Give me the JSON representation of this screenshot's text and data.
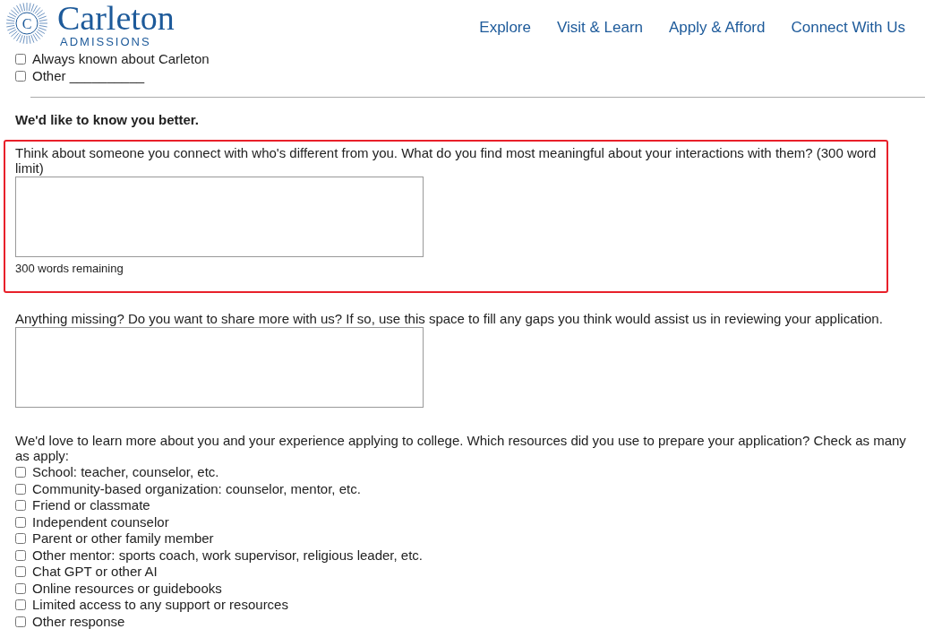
{
  "header": {
    "logo": {
      "title": "Carleton",
      "subtitle": "ADMISSIONS",
      "mark": "C"
    },
    "nav": [
      "Explore",
      "Visit & Learn",
      "Apply & Afford",
      "Connect With Us"
    ]
  },
  "top_options": [
    {
      "label": "Always known about Carleton",
      "checked": false
    },
    {
      "label": "Other __________",
      "checked": false
    }
  ],
  "section_title": "We'd like to know you better.",
  "questions": [
    {
      "prompt": "Think about someone you connect with who's different from you. What do you find most meaningful about your interactions with them? (300 word limit)",
      "counter": "300 words remaining",
      "highlighted": true
    },
    {
      "prompt": "Anything missing? Do you want to share more with us? If so, use this space to fill any gaps you think would assist us in reviewing your application.",
      "highlighted": false
    }
  ],
  "resources": {
    "prompt": "We'd love to learn more about you and your experience applying to college. Which resources did you use to prepare your application? Check as many as apply:",
    "options": [
      {
        "label": "School: teacher, counselor, etc.",
        "checked": false
      },
      {
        "label": "Community-based organization: counselor, mentor, etc.",
        "checked": false
      },
      {
        "label": "Friend or classmate",
        "checked": false
      },
      {
        "label": "Independent counselor",
        "checked": false
      },
      {
        "label": "Parent or other family member",
        "checked": false
      },
      {
        "label": "Other mentor: sports coach, work supervisor, religious leader, etc.",
        "checked": false
      },
      {
        "label": "Chat GPT or other AI",
        "checked": false
      },
      {
        "label": "Online resources or guidebooks",
        "checked": false
      },
      {
        "label": "Limited access to any support or resources",
        "checked": false
      },
      {
        "label": "Other response",
        "checked": false
      }
    ]
  }
}
